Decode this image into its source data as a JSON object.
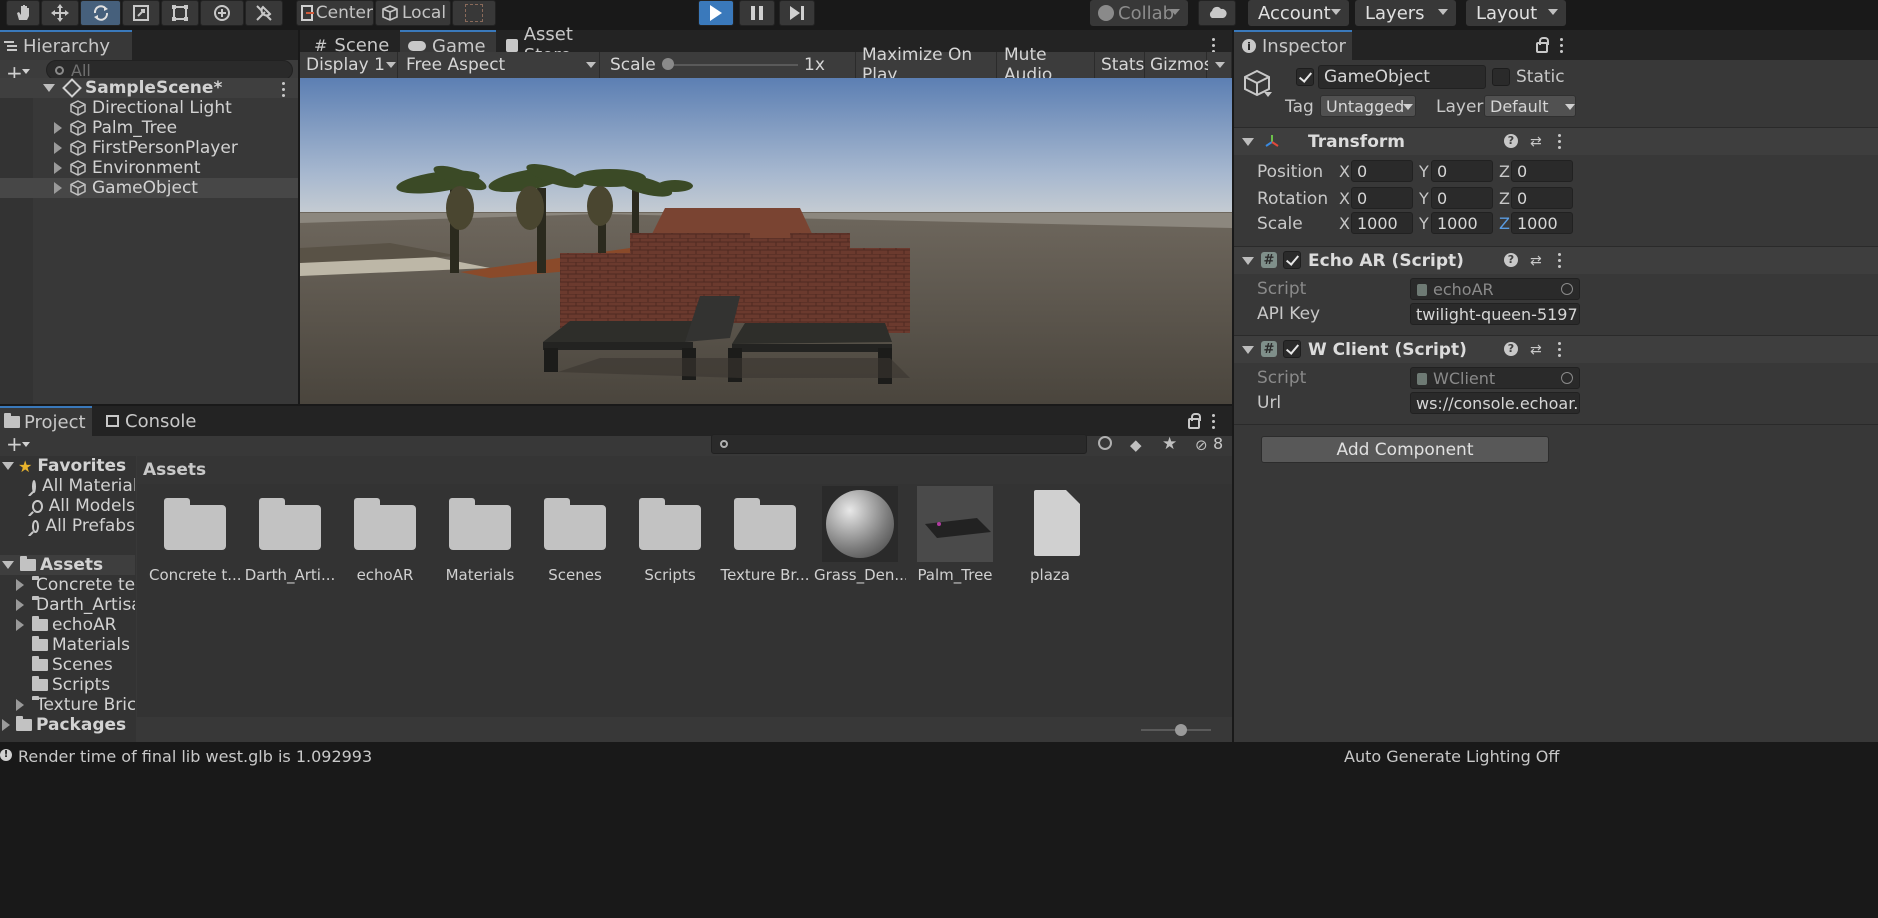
{
  "toolbar": {
    "tools": [
      "hand-tool-icon",
      "move-tool-icon",
      "rotate-tool-icon",
      "scale-tool-icon",
      "rect-tool-icon",
      "transform-tool-icon",
      "custom-tool-icon"
    ],
    "pivot_label": "Center",
    "space_label": "Local",
    "collab_label": "Collab",
    "account_label": "Account",
    "layers_label": "Layers",
    "layout_label": "Layout"
  },
  "hierarchy": {
    "tab_label": "Hierarchy",
    "search_placeholder": "All",
    "scene_name": "SampleScene*",
    "items": [
      {
        "label": "Directional Light",
        "expandable": false
      },
      {
        "label": "Palm_Tree",
        "expandable": true
      },
      {
        "label": "FirstPersonPlayer",
        "expandable": true
      },
      {
        "label": "Environment",
        "expandable": true
      },
      {
        "label": "GameObject",
        "expandable": true,
        "selected": true
      }
    ]
  },
  "center_tabs": {
    "scene": "Scene",
    "game": "Game",
    "asset_store": "Asset Store"
  },
  "game_bar": {
    "display": "Display 1",
    "aspect": "Free Aspect",
    "scale_label": "Scale",
    "scale_value": "1x",
    "maximize": "Maximize On Play",
    "mute": "Mute Audio",
    "stats": "Stats",
    "gizmos": "Gizmos"
  },
  "inspector": {
    "tab_label": "Inspector",
    "object_name": "GameObject",
    "static_label": "Static",
    "tag_label": "Tag",
    "tag_value": "Untagged",
    "layer_label": "Layer",
    "layer_value": "Default",
    "transform": {
      "title": "Transform",
      "position_label": "Position",
      "rotation_label": "Rotation",
      "scale_label": "Scale",
      "position": {
        "x": "0",
        "y": "0",
        "z": "0"
      },
      "rotation": {
        "x": "0",
        "y": "0",
        "z": "0"
      },
      "scale": {
        "x": "1000",
        "y": "1000",
        "z": "1000"
      },
      "axis_x": "X",
      "axis_y": "Y",
      "axis_z": "Z"
    },
    "echo": {
      "title": "Echo AR (Script)",
      "script_label": "Script",
      "script_value": "echoAR",
      "api_label": "API Key",
      "api_value": "twilight-queen-5197"
    },
    "wclient": {
      "title": "W Client (Script)",
      "script_label": "Script",
      "script_value": "WClient",
      "url_label": "Url",
      "url_value": "ws://console.echoar.x"
    },
    "add_component": "Add Component"
  },
  "project": {
    "tab_project": "Project",
    "tab_console": "Console",
    "hidden_count": "8",
    "favorites_label": "Favorites",
    "favorites": [
      "All Material",
      "All Models",
      "All Prefabs"
    ],
    "assets_label": "Assets",
    "tree": [
      {
        "label": "Concrete te",
        "expandable": true
      },
      {
        "label": "Darth_Artisa",
        "expandable": true
      },
      {
        "label": "echoAR",
        "expandable": true
      },
      {
        "label": "Materials",
        "expandable": false
      },
      {
        "label": "Scenes",
        "expandable": false
      },
      {
        "label": "Scripts",
        "expandable": false
      },
      {
        "label": "Texture Bric",
        "expandable": true
      }
    ],
    "packages_label": "Packages",
    "breadcrumb": "Assets",
    "grid": [
      {
        "label": "Concrete t...",
        "kind": "folder"
      },
      {
        "label": "Darth_Arti...",
        "kind": "folder"
      },
      {
        "label": "echoAR",
        "kind": "folder"
      },
      {
        "label": "Materials",
        "kind": "folder"
      },
      {
        "label": "Scenes",
        "kind": "folder"
      },
      {
        "label": "Scripts",
        "kind": "folder"
      },
      {
        "label": "Texture Br...",
        "kind": "folder"
      },
      {
        "label": "Grass_Den...",
        "kind": "material"
      },
      {
        "label": "Palm_Tree",
        "kind": "model"
      },
      {
        "label": "plaza",
        "kind": "file"
      }
    ]
  },
  "status": {
    "message": "Render time of final lib west.glb is 1.092993",
    "right": "Auto Generate Lighting Off"
  },
  "colors": {
    "accent": "#3a79bb",
    "panel": "#383838",
    "dark": "#191919"
  }
}
